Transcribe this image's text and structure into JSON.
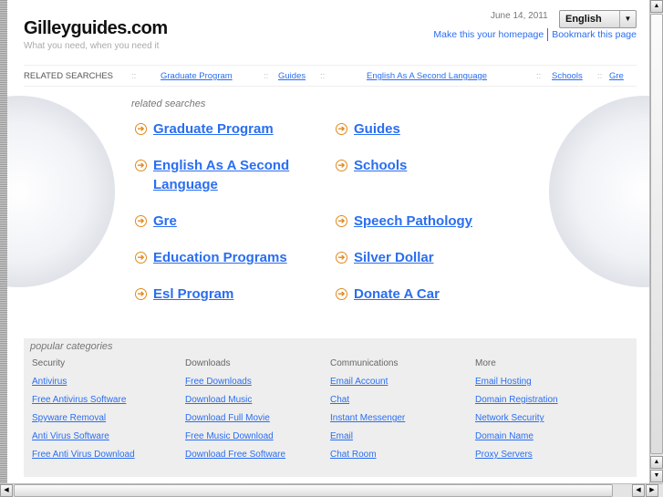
{
  "header": {
    "site_title": "Gilleyguides.com",
    "tagline": "What you need, when you need it",
    "date": "June 14, 2011",
    "language": "English",
    "make_homepage": "Make this your homepage",
    "bookmark": "Bookmark this page"
  },
  "related_bar": {
    "label": "RELATED SEARCHES",
    "links": [
      "Graduate Program",
      "Guides",
      "English As A Second Language",
      "Schools",
      "Gre"
    ]
  },
  "related": {
    "heading": "related searches",
    "left": [
      "Graduate Program",
      "English As A Second Language",
      "Gre",
      "Education Programs",
      "Esl Program"
    ],
    "right": [
      "Guides",
      "Schools",
      "Speech Pathology",
      "Silver Dollar",
      "Donate A Car"
    ]
  },
  "popular": {
    "heading": "popular categories",
    "columns": [
      {
        "title": "Security",
        "links": [
          "Antivirus",
          "Free Antivirus Software",
          "Spyware Removal",
          "Anti Virus Software",
          "Free Anti Virus Download"
        ]
      },
      {
        "title": "Downloads",
        "links": [
          "Free Downloads",
          "Download Music",
          "Download Full Movie",
          "Free Music Download",
          "Download Free Software"
        ]
      },
      {
        "title": "Communications",
        "links": [
          "Email Account",
          "Chat",
          "Instant Messenger",
          "Email",
          "Chat Room"
        ]
      },
      {
        "title": "More",
        "links": [
          "Email Hosting",
          "Domain Registration",
          "Network Security",
          "Domain Name",
          "Proxy Servers"
        ]
      }
    ]
  },
  "colors": {
    "link": "#2a6ef0",
    "bullet": "#e08a1e",
    "panel": "#eeeeee"
  }
}
